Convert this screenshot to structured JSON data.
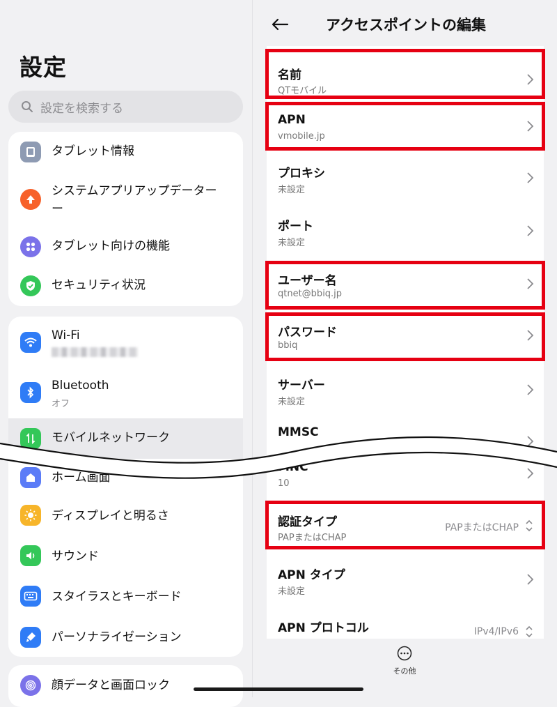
{
  "left": {
    "title": "設定",
    "search_placeholder": "設定を検索する",
    "group1": [
      {
        "label": "タブレット情報",
        "icon": "tablet-icon",
        "color": "#8e9bb3"
      },
      {
        "label": "システムアプリアップデーター",
        "label_line2": "ー",
        "icon": "upload-icon",
        "color": "#f7612a"
      },
      {
        "label": "タブレット向けの機能",
        "icon": "grid-dots-icon",
        "color": "#7b72e9"
      },
      {
        "label": "セキュリティ状況",
        "icon": "shield-check-icon",
        "color": "#34c759"
      }
    ],
    "group2": [
      {
        "label": "Wi-Fi",
        "icon": "wifi-icon",
        "color": "#2f7cf6"
      },
      {
        "label": "Bluetooth",
        "sub": "オフ",
        "icon": "bluetooth-icon",
        "color": "#2f7cf6"
      },
      {
        "label": "モバイルネットワーク",
        "icon": "mobile-data-icon",
        "color": "#34c759"
      },
      {
        "label": "ホーム画面",
        "icon": "home-icon",
        "color": "#5b7cf7"
      },
      {
        "label": "ディスプレイと明るさ",
        "icon": "sun-icon",
        "color": "#f7b52a"
      },
      {
        "label": "サウンド",
        "icon": "speaker-icon",
        "color": "#34c759"
      },
      {
        "label": "スタイラスとキーボード",
        "icon": "keyboard-icon",
        "color": "#2f7cf6"
      },
      {
        "label": "パーソナライゼーション",
        "icon": "brush-icon",
        "color": "#2f7cf6"
      }
    ],
    "group3": [
      {
        "label": "顔データと画面ロック",
        "icon": "fingerprint-icon",
        "color": "#7b72e9"
      }
    ]
  },
  "right": {
    "title": "アクセスポイントの編集",
    "rows": [
      {
        "label": "名前",
        "value": "QTモバイル"
      },
      {
        "label": "APN",
        "value": "vmobile.jp"
      },
      {
        "label": "プロキシ",
        "value": "未設定"
      },
      {
        "label": "ポート",
        "value": "未設定"
      },
      {
        "label": "ユーザー名",
        "value": "qtnet@bbiq.jp"
      },
      {
        "label": "パスワード",
        "value": "bbiq"
      },
      {
        "label": "サーバー",
        "value": "未設定"
      },
      {
        "label": "MMSC",
        "value": ""
      },
      {
        "label": "MNC",
        "value": "10"
      },
      {
        "label": "認証タイプ",
        "value": "PAPまたはCHAP",
        "selected": "PAPまたはCHAP"
      },
      {
        "label": "APN タイプ",
        "value": "未設定"
      },
      {
        "label": "APN プロトコル",
        "value": "",
        "selected": "IPv4/IPv6"
      }
    ],
    "more_label": "その他"
  },
  "colors": {
    "highlight": "#e60012",
    "accent": "#2f7cf6"
  }
}
